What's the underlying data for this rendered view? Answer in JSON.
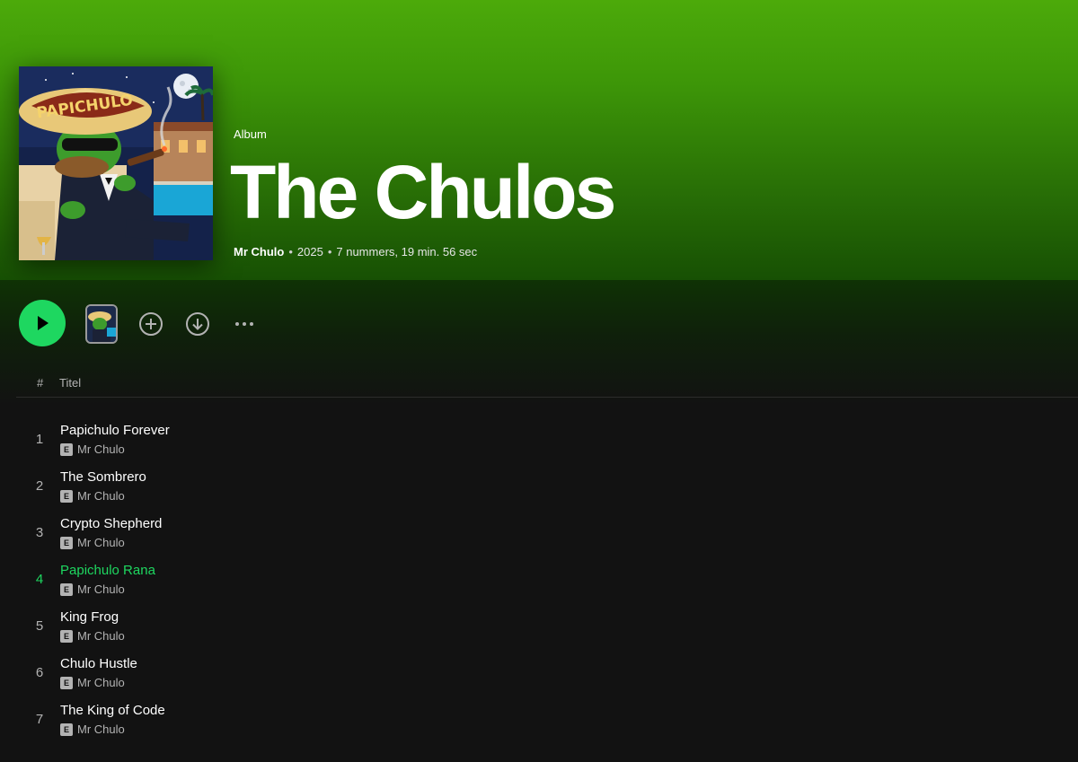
{
  "album": {
    "type_label": "Album",
    "title": "The Chulos",
    "artist": "Mr Chulo",
    "year": "2025",
    "stats": "7 nummers, 19 min. 56 sec",
    "separator": "•",
    "cover_text": "PAPICHULO"
  },
  "controls": {
    "play_icon": "play-icon",
    "add_icon": "plus-circle-icon",
    "download_icon": "download-icon",
    "more_icon": "more-horizontal-icon"
  },
  "list_header": {
    "number": "#",
    "title": "Titel"
  },
  "tracks": [
    {
      "number": "1",
      "title": "Papichulo Forever",
      "artist": "Mr Chulo",
      "explicit": "E"
    },
    {
      "number": "2",
      "title": "The Sombrero",
      "artist": "Mr Chulo",
      "explicit": "E"
    },
    {
      "number": "3",
      "title": "Crypto Shepherd",
      "artist": "Mr Chulo",
      "explicit": "E"
    },
    {
      "number": "4",
      "title": "Papichulo Rana",
      "artist": "Mr Chulo",
      "explicit": "E"
    },
    {
      "number": "5",
      "title": "King Frog",
      "artist": "Mr Chulo",
      "explicit": "E"
    },
    {
      "number": "6",
      "title": "Chulo Hustle",
      "artist": "Mr Chulo",
      "explicit": "E"
    },
    {
      "number": "7",
      "title": "The King of Code",
      "artist": "Mr Chulo",
      "explicit": "E"
    }
  ],
  "colors": {
    "accent": "#1ed760",
    "header_green": "#4caa0a",
    "background": "#121212"
  }
}
